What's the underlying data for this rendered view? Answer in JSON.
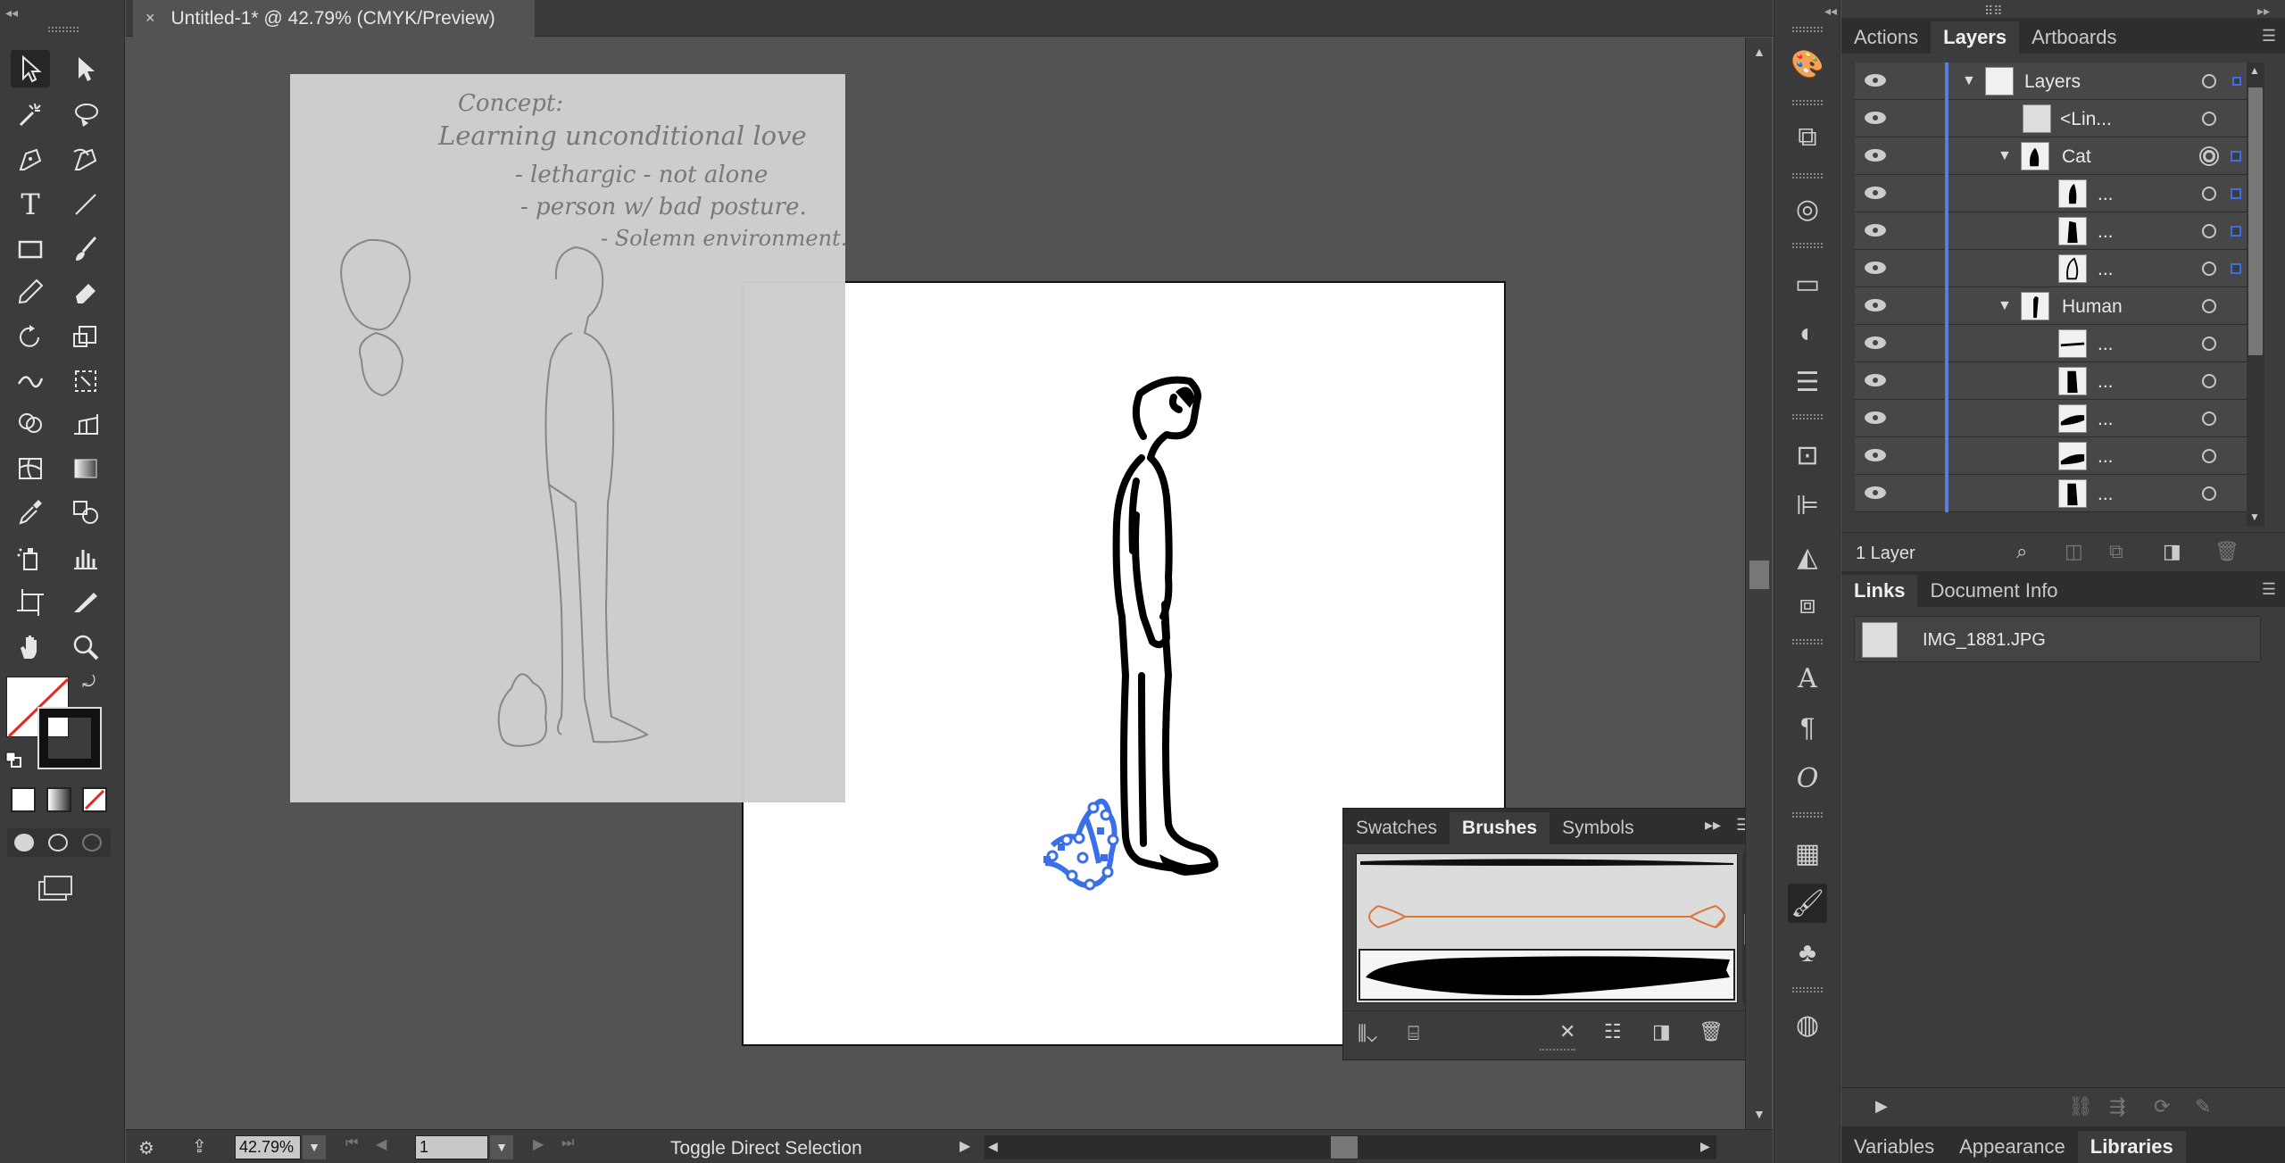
{
  "document": {
    "tab_title": "Untitled-1* @ 42.79% (CMYK/Preview)",
    "close_glyph": "×"
  },
  "sketch": {
    "lines": [
      "Concept:",
      "Learning unconditional love",
      "- lethargic - not alone",
      "- person w/ bad posture.",
      "- Solemn environment."
    ]
  },
  "status_bar": {
    "zoom": "42.79%",
    "artboard_number": "1",
    "current_tool": "Toggle Direct Selection"
  },
  "layers_panel": {
    "tabs": [
      "Actions",
      "Layers",
      "Artboards"
    ],
    "active_tab": "Layers",
    "rows": [
      {
        "name": "Layers",
        "expanded": true
      },
      {
        "name": "<Lin..."
      },
      {
        "name": "Cat",
        "expanded": true
      },
      {
        "name": "..."
      },
      {
        "name": "..."
      },
      {
        "name": "..."
      },
      {
        "name": "Human",
        "expanded": true
      },
      {
        "name": "..."
      },
      {
        "name": "..."
      },
      {
        "name": "..."
      },
      {
        "name": "..."
      },
      {
        "name": "..."
      }
    ],
    "footer_count": "1 Layer"
  },
  "links_panel": {
    "tabs": [
      "Links",
      "Document Info"
    ],
    "active_tab": "Links",
    "items": [
      {
        "name": "IMG_1881.JPG"
      }
    ]
  },
  "bottom_tabs": {
    "tabs": [
      "Variables",
      "Appearance",
      "Libraries"
    ],
    "active_tab": "Libraries"
  },
  "brushes_panel": {
    "tabs": [
      "Swatches",
      "Brushes",
      "Symbols"
    ],
    "active_tab": "Brushes"
  },
  "colors": {
    "selection_blue": "#3a6fe8",
    "layer_bar_blue": "#5a7fd8",
    "brush_orange": "#d9763a"
  }
}
